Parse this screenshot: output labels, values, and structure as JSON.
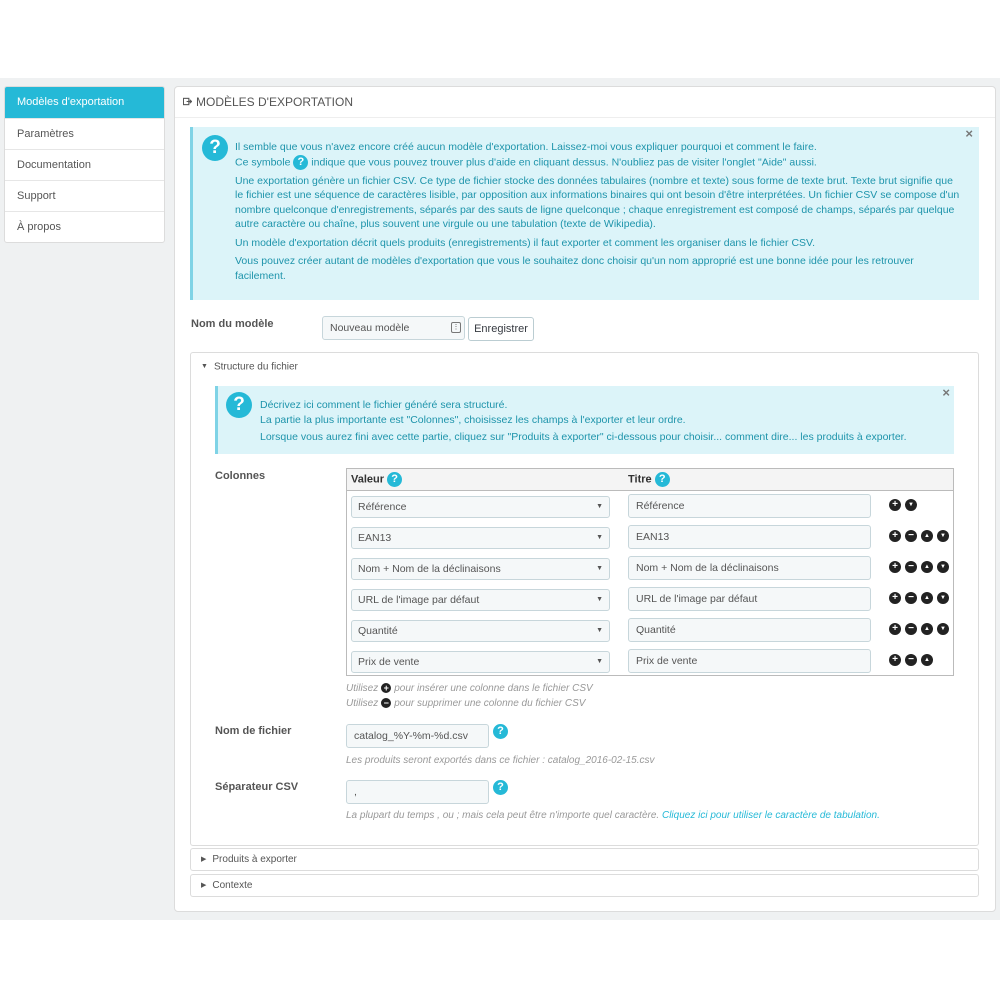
{
  "sidebar": {
    "items": [
      {
        "label": "Modèles d'exportation"
      },
      {
        "label": "Paramètres"
      },
      {
        "label": "Documentation"
      },
      {
        "label": "Support"
      },
      {
        "label": "À propos"
      }
    ]
  },
  "panel": {
    "title": "MODÈLES D'EXPORTATION",
    "intro": {
      "line1": "Il semble que vous n'avez encore créé aucun modèle d'exportation. Laissez-moi vous expliquer pourquoi et comment le faire.",
      "line2_before": "Ce symbole",
      "line2_after": "indique que vous pouvez trouver plus d'aide en cliquant dessus. N'oubliez pas de visiter l'onglet \"Aide\" aussi.",
      "p2": "Une exportation génère un fichier CSV. Ce type de fichier stocke des données tabulaires (nombre et texte) sous forme de texte brut. Texte brut signifie que le fichier est une séquence de caractères lisible, par opposition aux informations binaires qui ont besoin d'être interprétées. Un fichier CSV se compose d'un nombre quelconque d'enregistrements, séparés par des sauts de ligne quelconque ; chaque enregistrement est composé de champs, séparés par quelque autre caractère ou chaîne, plus souvent une virgule ou une tabulation (texte de Wikipedia).",
      "p3": "Un modèle d'exportation décrit quels produits (enregistrements) il faut exporter et comment les organiser dans le fichier CSV.",
      "p4": "Vous pouvez créer autant de modèles d'exportation que vous le souhaitez donc choisir qu'un nom approprié est une bonne idée pour les retrouver facilement."
    },
    "model_name_label": "Nom du modèle",
    "model_name_value": "Nouveau modèle",
    "save_label": "Enregistrer"
  },
  "structure": {
    "title": "Structure du fichier",
    "info": {
      "l1": "Décrivez ici comment le fichier généré sera structuré.",
      "l2": "La partie la plus importante est \"Colonnes\", choisissez les champs à l'exporter et leur ordre.",
      "l3": "Lorsque vous aurez fini avec cette partie, cliquez sur \"Produits à exporter\" ci-dessous pour choisir... comment dire... les produits à exporter."
    },
    "columns_label": "Colonnes",
    "header_value": "Valeur",
    "header_title": "Titre",
    "rows": [
      {
        "value": "Référence",
        "title": "Référence"
      },
      {
        "value": "EAN13",
        "title": "EAN13"
      },
      {
        "value": "Nom + Nom de la déclinaisons",
        "title": "Nom + Nom de la déclinaisons"
      },
      {
        "value": "URL de l'image par défaut",
        "title": "URL de l'image par défaut"
      },
      {
        "value": "Quantité",
        "title": "Quantité"
      },
      {
        "value": "Prix de vente",
        "title": "Prix de vente"
      }
    ],
    "help_insert_a": "Utilisez",
    "help_insert_b": "pour insérer une colonne dans le fichier CSV",
    "help_remove_a": "Utilisez",
    "help_remove_b": "pour supprimer une colonne du fichier CSV",
    "filename_label": "Nom de fichier",
    "filename_value": "catalog_%Y-%m-%d.csv",
    "filename_help": "Les produits seront exportés dans ce fichier : catalog_2016-02-15.csv",
    "separator_label": "Séparateur CSV",
    "separator_value": ",",
    "separator_help": "La plupart du temps , ou ; mais cela peut être n'importe quel caractère.",
    "separator_link": "Cliquez ici pour utiliser le caractère de tabulation."
  },
  "sections": {
    "products": "Produits à exporter",
    "context": "Contexte"
  },
  "icons": {
    "help": "?",
    "close": "×",
    "plus": "+",
    "minus": "−",
    "up": "▲",
    "down": "▼"
  },
  "colors": {
    "accent": "#25b9d7",
    "info_bg": "#dcf4f9",
    "info_text": "#1e94ab"
  }
}
